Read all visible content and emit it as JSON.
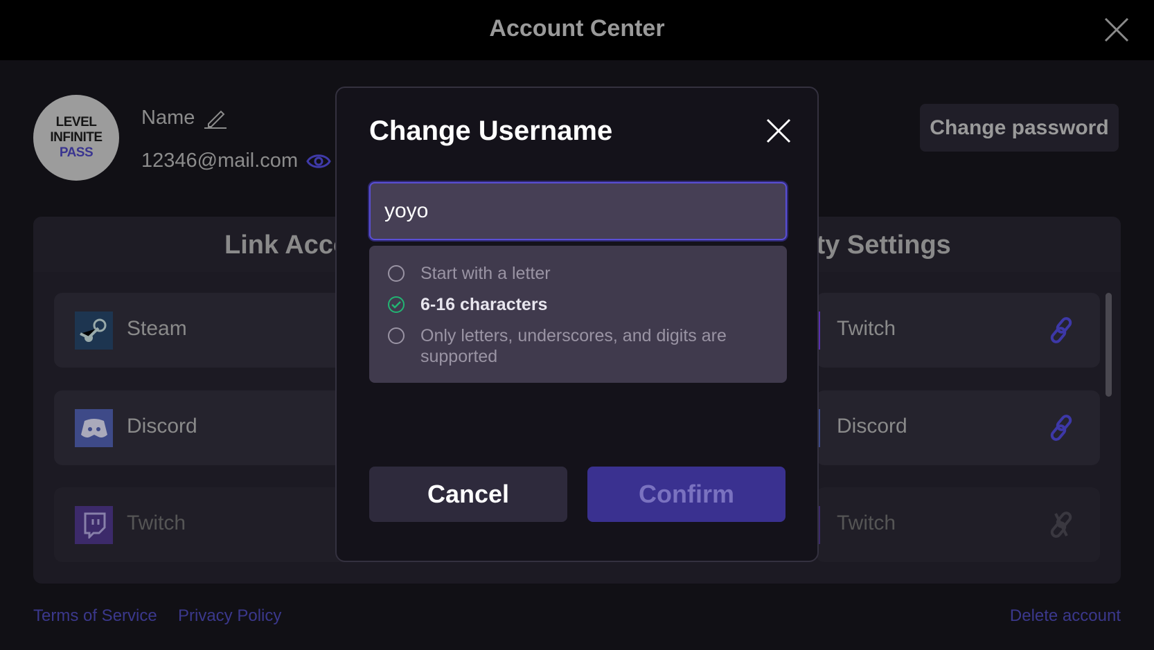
{
  "header": {
    "title": "Account Center",
    "close_icon": "close-icon"
  },
  "profile": {
    "avatar_lines": [
      "LEVEL",
      "INFINITE",
      "PASS"
    ],
    "name": "Name",
    "email": "12346@mail.com",
    "change_password": "Change password"
  },
  "panel": {
    "link_accounts_title": "Link Acco",
    "security_title": "ity Settings",
    "left_rows": [
      {
        "label": "Steam",
        "icon": "steam-icon"
      },
      {
        "label": "Discord",
        "icon": "discord-icon"
      },
      {
        "label": "Twitch",
        "icon": "twitch-icon"
      }
    ],
    "right_rows": [
      {
        "label": "Twitch",
        "status": "linked"
      },
      {
        "label": "Discord",
        "status": "linked"
      },
      {
        "label": "Twitch",
        "status": "unlinked"
      }
    ]
  },
  "footer": {
    "terms": "Terms of Service",
    "privacy": "Privacy Policy",
    "delete": "Delete account"
  },
  "modal": {
    "title": "Change Username",
    "input_value": "yoyo",
    "rules": [
      {
        "text": "Start with a letter",
        "met": false
      },
      {
        "text": "6-16 characters",
        "met": true
      },
      {
        "text": "Only letters, underscores, and digits are supported",
        "met": false
      }
    ],
    "cancel": "Cancel",
    "confirm": "Confirm"
  },
  "colors": {
    "accent": "#5a4fd6",
    "success": "#22b573",
    "confirm_bg": "#3a3190"
  }
}
